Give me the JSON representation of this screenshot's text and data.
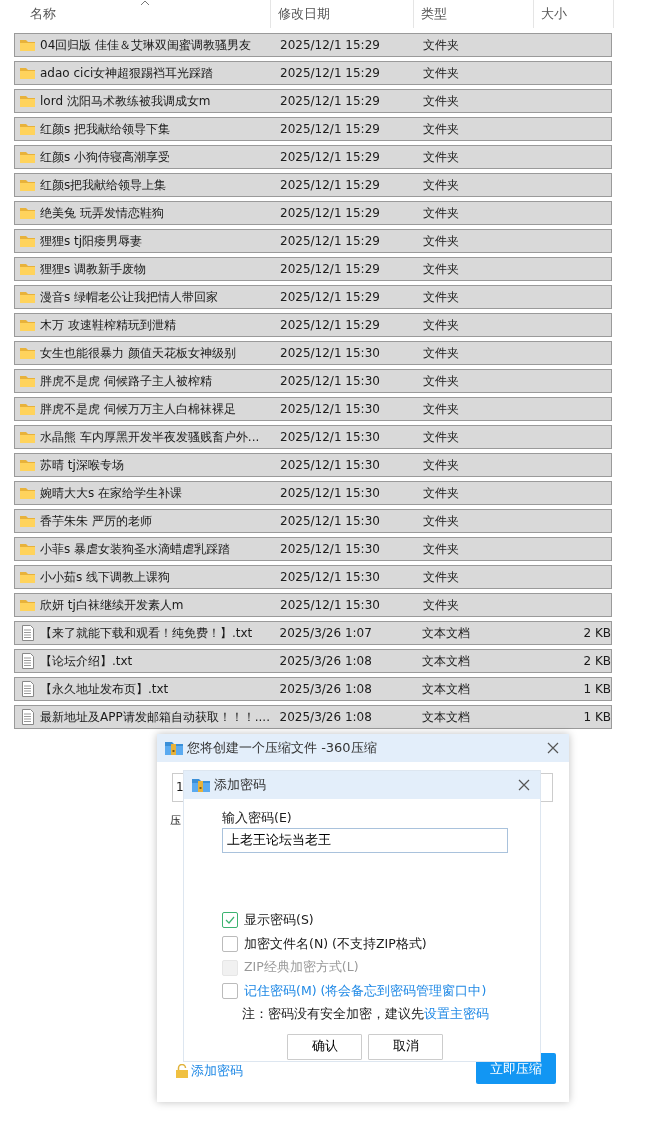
{
  "file_list": {
    "columns": [
      {
        "label": "名称",
        "sorted": true
      },
      {
        "label": "修改日期",
        "sorted": false
      },
      {
        "label": "类型",
        "sorted": false
      },
      {
        "label": "大小",
        "sorted": false
      }
    ],
    "rows": [
      {
        "kind": "folder",
        "name": "04回归版 佳佳＆艾琳双闺蜜调教骚男友",
        "date": "2025/12/1 15:29",
        "type": "文件夹",
        "selected": true
      },
      {
        "kind": "folder",
        "name": "adao cici女神超狠踢裆耳光踩踏",
        "date": "2025/12/1 15:29",
        "type": "文件夹",
        "selected": true
      },
      {
        "kind": "folder",
        "name": "lord 沈阳马术教练被我调成女m",
        "date": "2025/12/1 15:29",
        "type": "文件夹",
        "selected": true
      },
      {
        "kind": "folder",
        "name": "红颜s 把我献给领导下集",
        "date": "2025/12/1 15:29",
        "type": "文件夹",
        "selected": true
      },
      {
        "kind": "folder",
        "name": "红颜s 小狗侍寝高潮享受",
        "date": "2025/12/1 15:29",
        "type": "文件夹",
        "selected": true
      },
      {
        "kind": "folder",
        "name": "红颜s把我献给领导上集",
        "date": "2025/12/1 15:29",
        "type": "文件夹",
        "selected": true
      },
      {
        "kind": "folder",
        "name": "绝美兔 玩弄发情恋鞋狗",
        "date": "2025/12/1 15:29",
        "type": "文件夹",
        "selected": true
      },
      {
        "kind": "folder",
        "name": "狸狸s tj阳痿男辱妻",
        "date": "2025/12/1 15:29",
        "type": "文件夹",
        "selected": true
      },
      {
        "kind": "folder",
        "name": "狸狸s 调教新手废物",
        "date": "2025/12/1 15:29",
        "type": "文件夹",
        "selected": true
      },
      {
        "kind": "folder",
        "name": "漫音s 绿帽老公让我把情人带回家",
        "date": "2025/12/1 15:29",
        "type": "文件夹",
        "selected": true
      },
      {
        "kind": "folder",
        "name": "木万 攻速鞋榨精玩到泄精",
        "date": "2025/12/1 15:29",
        "type": "文件夹",
        "selected": true
      },
      {
        "kind": "folder",
        "name": "女生也能很暴力 颜值天花板女神级别",
        "date": "2025/12/1 15:30",
        "type": "文件夹",
        "selected": true
      },
      {
        "kind": "folder",
        "name": "胖虎不是虎 伺候路子主人被榨精",
        "date": "2025/12/1 15:30",
        "type": "文件夹",
        "selected": true
      },
      {
        "kind": "folder",
        "name": "胖虎不是虎 伺候万万主人白棉袜裸足",
        "date": "2025/12/1 15:30",
        "type": "文件夹",
        "selected": true
      },
      {
        "kind": "folder",
        "name": "水晶熊 车内厚黑开发半夜发骚贱畜户外...",
        "date": "2025/12/1 15:30",
        "type": "文件夹",
        "selected": true
      },
      {
        "kind": "folder",
        "name": "苏晴 tj深喉专场",
        "date": "2025/12/1 15:30",
        "type": "文件夹",
        "selected": true
      },
      {
        "kind": "folder",
        "name": "婉晴大大s 在家给学生补课",
        "date": "2025/12/1 15:30",
        "type": "文件夹",
        "selected": true
      },
      {
        "kind": "folder",
        "name": "香芋朱朱 严厉的老师",
        "date": "2025/12/1 15:30",
        "type": "文件夹",
        "selected": true
      },
      {
        "kind": "folder",
        "name": "小菲s 暴虐女装狗圣水滴蜡虐乳踩踏",
        "date": "2025/12/1 15:30",
        "type": "文件夹",
        "selected": true
      },
      {
        "kind": "folder",
        "name": "小小茹s 线下调教上课狗",
        "date": "2025/12/1 15:30",
        "type": "文件夹",
        "selected": true
      },
      {
        "kind": "folder",
        "name": "欣妍 tj白袜继续开发素人m",
        "date": "2025/12/1 15:30",
        "type": "文件夹",
        "selected": true
      },
      {
        "kind": "text",
        "name": "【来了就能下载和观看！纯免费！】.txt",
        "date": "2025/3/26 1:07",
        "type": "文本文档",
        "size": "2 KB",
        "selected": true
      },
      {
        "kind": "text",
        "name": "【论坛介绍】.txt",
        "date": "2025/3/26 1:08",
        "type": "文本文档",
        "size": "2 KB",
        "selected": true
      },
      {
        "kind": "text",
        "name": "【永久地址发布页】.txt",
        "date": "2025/3/26 1:08",
        "type": "文本文档",
        "size": "1 KB",
        "selected": true
      },
      {
        "kind": "text",
        "name": "最新地址及APP请发邮箱自动获取！！！....",
        "date": "2025/3/26 1:08",
        "type": "文本文档",
        "size": "1 KB",
        "selected": true
      }
    ]
  },
  "compress_window": {
    "title": "您将创建一个压缩文件 -360压缩",
    "field_value": "1",
    "label_fragment": "压",
    "add_password_link": "添加密码",
    "compress_button": "立即压缩"
  },
  "password_dialog": {
    "title": "添加密码",
    "field_label": "输入密码(E)",
    "password": "上老王论坛当老王",
    "options": [
      {
        "label": "显示密码(S)",
        "checked": true,
        "disabled": false,
        "link": false
      },
      {
        "label": "加密文件名(N) (不支持ZIP格式)",
        "checked": false,
        "disabled": false,
        "link": false
      },
      {
        "label": "ZIP经典加密方式(L)",
        "checked": false,
        "disabled": true,
        "link": false
      },
      {
        "label": "记住密码(M) (将会备忘到密码管理窗口中)",
        "checked": false,
        "disabled": false,
        "link": true
      }
    ],
    "note": "注：密码没有安全加密，建议先",
    "note_link": "设置主密码",
    "buttons": [
      "确认",
      "取消"
    ]
  }
}
